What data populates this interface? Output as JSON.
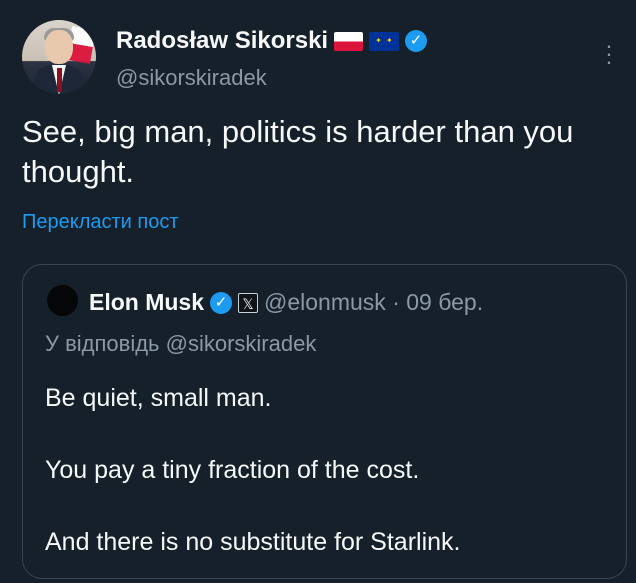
{
  "author": {
    "name": "Radosław Sikorski",
    "handle": "@sikorskiradek",
    "verified_icon": "✓",
    "flags": [
      "polish-flag",
      "eu-flag"
    ]
  },
  "tweet": {
    "text": "See, big man, politics is harder than you thought.",
    "translate_label": "Перекласти пост"
  },
  "quoted_tweet": {
    "name": "Elon Musk",
    "verified_icon": "✓",
    "affiliate_badge": "𝕏",
    "handle_and_date": "@elonmusk · 09 бер.",
    "reply_to": "У відповідь @sikorskiradek",
    "lines": [
      "Be quiet, small man.",
      "You pay a tiny fraction of the cost.",
      "And there is no substitute for Starlink."
    ]
  },
  "colors": {
    "background": "#15202b",
    "text": "#f7f9f9",
    "muted": "#8b98a5",
    "accent": "#1d9bf0",
    "border": "#38444d"
  },
  "icons": [
    "avatar",
    "polish-flag-icon",
    "eu-flag-icon",
    "verified-icon",
    "more-options-icon",
    "x-affiliate-icon"
  ]
}
